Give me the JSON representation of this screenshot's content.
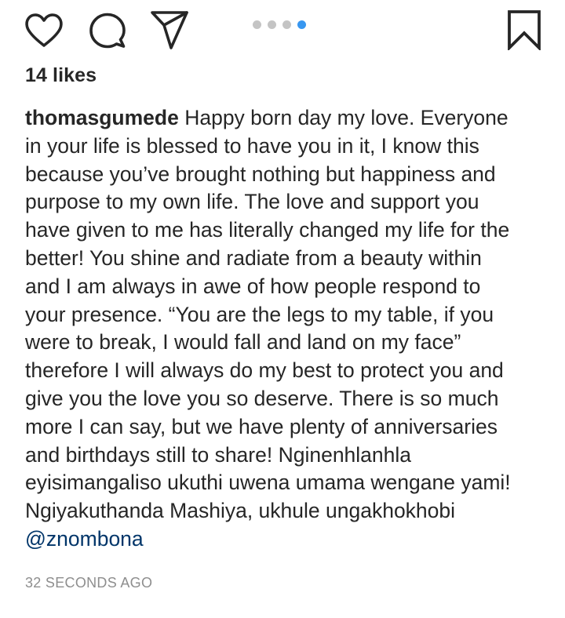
{
  "action_bar": {
    "icons": {
      "like": "heart-icon",
      "comment": "comment-bubble-icon",
      "share": "paper-plane-icon",
      "save": "bookmark-icon"
    },
    "carousel": {
      "total_dots": 4,
      "active_index": 3,
      "active_color": "#3897f0",
      "inactive_color": "#c4c4c4"
    }
  },
  "likes": {
    "label": "14 likes"
  },
  "caption": {
    "username": "thomasgumede",
    "first_line_text": " Happy born day my love. Everyone",
    "lines": [
      "in your life is blessed to have you in it, I know this",
      "because you’ve brought nothing but happiness and",
      "purpose to my own life. The love and support you",
      "have given to me has literally changed my life for the",
      "better! You shine and radiate from a beauty within",
      "and I am always in awe of how people respond to",
      "your presence. “You are the legs to my table, if you",
      "were to break, I would fall and land on my face”",
      "therefore I will always do my best to protect you and",
      "give you the love you so deserve. There is so much",
      "more I can say, but we have plenty of anniversaries",
      "and birthdays still to share! Nginenhlanhla",
      "eyisimangaliso ukuthi uwena umama wengane yami!",
      "Ngiyakuthanda Mashiya, ukhule ungakhokhobi"
    ],
    "mention": "@znombona",
    "mention_color": "#003569"
  },
  "timestamp": "32 SECONDS AGO"
}
